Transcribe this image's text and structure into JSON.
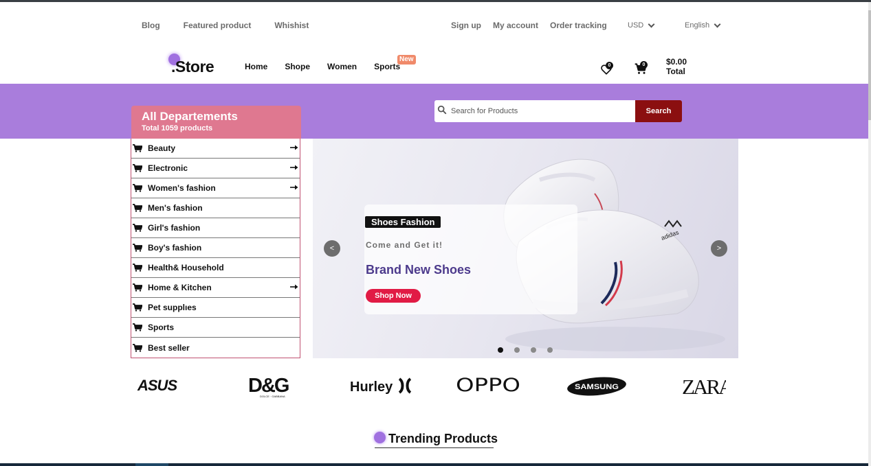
{
  "top_links_left": [
    "Blog",
    "Featured product",
    "Whishist"
  ],
  "top_links_right": [
    "Sign up",
    "My account",
    "Order tracking"
  ],
  "currency": "USD",
  "language": "English",
  "logo": ".Store",
  "nav": [
    "Home",
    "Shope",
    "Women",
    "Sports"
  ],
  "nav_badge": "New",
  "wishlist_count": "0",
  "cart_count": "0",
  "cart_amount": "$0.00",
  "cart_total_label": "Total",
  "departments": {
    "title": "All Departements",
    "subtitle": "Total 1059 products",
    "items": [
      {
        "label": "Beauty",
        "has_arrow": true
      },
      {
        "label": "Electronic",
        "has_arrow": true
      },
      {
        "label": "Women's fashion",
        "has_arrow": true
      },
      {
        "label": "Men's fashion",
        "has_arrow": false
      },
      {
        "label": "Girl's fashion",
        "has_arrow": false
      },
      {
        "label": "Boy's fashion",
        "has_arrow": false
      },
      {
        "label": "Health& Household",
        "has_arrow": false
      },
      {
        "label": "Home & Kitchen",
        "has_arrow": true
      },
      {
        "label": "Pet supplıes",
        "has_arrow": false
      },
      {
        "label": "Sports",
        "has_arrow": false
      },
      {
        "label": "Best seller",
        "has_arrow": false
      }
    ]
  },
  "search": {
    "placeholder": "Search for Products",
    "button": "Search"
  },
  "hero": {
    "tag": "Shoes Fashion",
    "subtitle": "Come and Get it!",
    "title": "Brand New Shoes",
    "button": "Shop Now",
    "prev": "<",
    "next": ">",
    "slide_count": 4,
    "active_slide": 1
  },
  "brands": [
    "ASUS",
    "D&G",
    "Hurley",
    "OPPO",
    "SAMSUNG",
    "ZARA"
  ],
  "brand_dg_small": "DOLCE · GABBANA",
  "trending_title": "Trending Products",
  "colors": {
    "purple_band": "#a97ddc",
    "dept_header": "#df7890",
    "search_button": "#8b0f10",
    "shop_now": "#e11b45",
    "hero_title": "#4c3a8c"
  }
}
